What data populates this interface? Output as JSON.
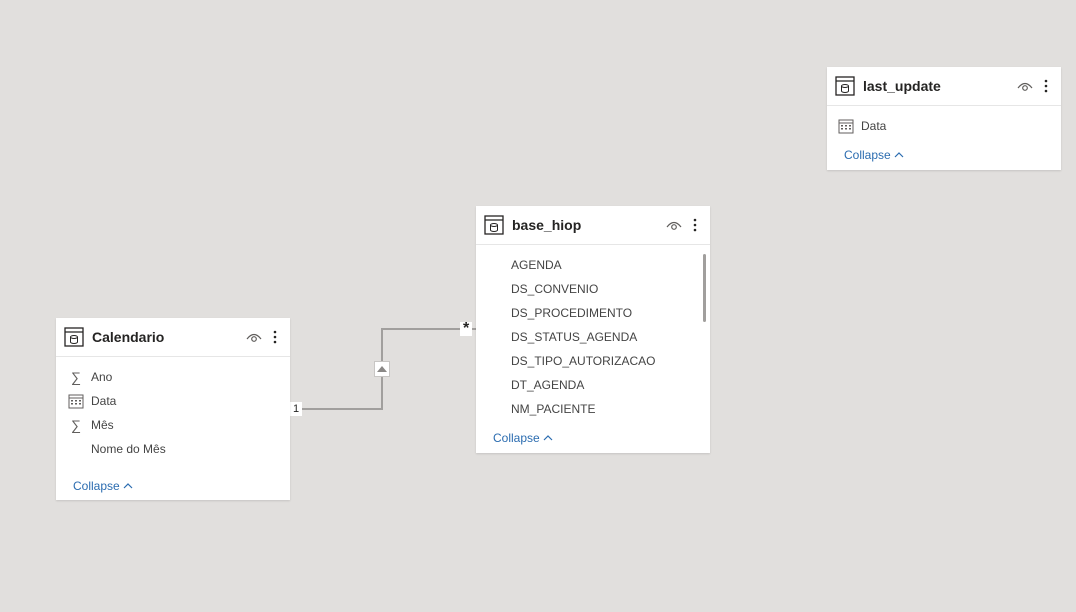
{
  "tables": {
    "last_update": {
      "title": "last_update",
      "fields": [
        {
          "name": "Data",
          "icon": "calendar-icon"
        }
      ],
      "collapse_label": "Collapse"
    },
    "base_hiop": {
      "title": "base_hiop",
      "fields": [
        {
          "name": "AGENDA",
          "icon": "none"
        },
        {
          "name": "DS_CONVENIO",
          "icon": "none"
        },
        {
          "name": "DS_PROCEDIMENTO",
          "icon": "none"
        },
        {
          "name": "DS_STATUS_AGENDA",
          "icon": "none"
        },
        {
          "name": "DS_TIPO_AUTORIZACAO",
          "icon": "none"
        },
        {
          "name": "DT_AGENDA",
          "icon": "none"
        },
        {
          "name": "NM_PACIENTE",
          "icon": "none"
        }
      ],
      "collapse_label": "Collapse"
    },
    "calendario": {
      "title": "Calendario",
      "fields": [
        {
          "name": "Ano",
          "icon": "sigma-icon"
        },
        {
          "name": "Data",
          "icon": "calendar-icon"
        },
        {
          "name": "Mês",
          "icon": "sigma-icon"
        },
        {
          "name": "Nome do Mês",
          "icon": "none"
        }
      ],
      "collapse_label": "Collapse"
    }
  },
  "relationship": {
    "one_side_label": "1",
    "many_side_label": "*"
  },
  "colors": {
    "canvas": "#e1dfdd",
    "link": "#2b6cb0",
    "line": "#a19f9d"
  }
}
